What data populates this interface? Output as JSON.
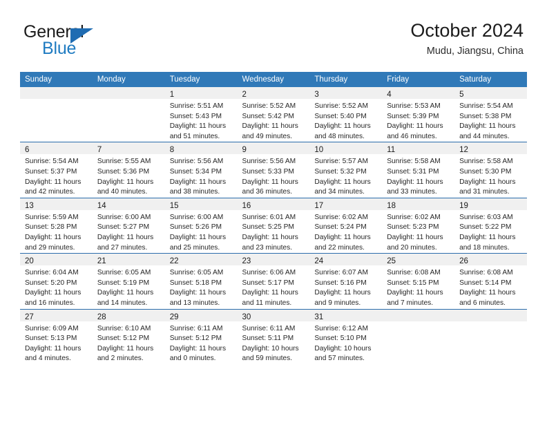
{
  "brand": {
    "name_top": "General",
    "name_bottom": "Blue",
    "triangle_icon": "blue-triangle-icon",
    "color_dark": "#1b1b1b",
    "color_blue": "#1f7bc1"
  },
  "header": {
    "title": "October 2024",
    "subtitle": "Mudu, Jiangsu, China"
  },
  "theme": {
    "header_bg": "#3079b8",
    "header_text": "#ffffff",
    "row_divider": "#2a6cac",
    "daynum_strip_bg": "#f0f0f0",
    "cell_bg": "#ffffff",
    "body_text": "#262626"
  },
  "weekday_headers": [
    "Sunday",
    "Monday",
    "Tuesday",
    "Wednesday",
    "Thursday",
    "Friday",
    "Saturday"
  ],
  "labels": {
    "sunrise": "Sunrise:",
    "sunset": "Sunset:",
    "daylight": "Daylight:"
  },
  "weeks": [
    [
      {
        "day": "",
        "sunrise": "",
        "sunset": "",
        "daylight_line1": "",
        "daylight_line2": "",
        "empty": true
      },
      {
        "day": "",
        "sunrise": "",
        "sunset": "",
        "daylight_line1": "",
        "daylight_line2": "",
        "empty": true
      },
      {
        "day": "1",
        "sunrise": "Sunrise: 5:51 AM",
        "sunset": "Sunset: 5:43 PM",
        "daylight_line1": "Daylight: 11 hours",
        "daylight_line2": "and 51 minutes."
      },
      {
        "day": "2",
        "sunrise": "Sunrise: 5:52 AM",
        "sunset": "Sunset: 5:42 PM",
        "daylight_line1": "Daylight: 11 hours",
        "daylight_line2": "and 49 minutes."
      },
      {
        "day": "3",
        "sunrise": "Sunrise: 5:52 AM",
        "sunset": "Sunset: 5:40 PM",
        "daylight_line1": "Daylight: 11 hours",
        "daylight_line2": "and 48 minutes."
      },
      {
        "day": "4",
        "sunrise": "Sunrise: 5:53 AM",
        "sunset": "Sunset: 5:39 PM",
        "daylight_line1": "Daylight: 11 hours",
        "daylight_line2": "and 46 minutes."
      },
      {
        "day": "5",
        "sunrise": "Sunrise: 5:54 AM",
        "sunset": "Sunset: 5:38 PM",
        "daylight_line1": "Daylight: 11 hours",
        "daylight_line2": "and 44 minutes."
      }
    ],
    [
      {
        "day": "6",
        "sunrise": "Sunrise: 5:54 AM",
        "sunset": "Sunset: 5:37 PM",
        "daylight_line1": "Daylight: 11 hours",
        "daylight_line2": "and 42 minutes."
      },
      {
        "day": "7",
        "sunrise": "Sunrise: 5:55 AM",
        "sunset": "Sunset: 5:36 PM",
        "daylight_line1": "Daylight: 11 hours",
        "daylight_line2": "and 40 minutes."
      },
      {
        "day": "8",
        "sunrise": "Sunrise: 5:56 AM",
        "sunset": "Sunset: 5:34 PM",
        "daylight_line1": "Daylight: 11 hours",
        "daylight_line2": "and 38 minutes."
      },
      {
        "day": "9",
        "sunrise": "Sunrise: 5:56 AM",
        "sunset": "Sunset: 5:33 PM",
        "daylight_line1": "Daylight: 11 hours",
        "daylight_line2": "and 36 minutes."
      },
      {
        "day": "10",
        "sunrise": "Sunrise: 5:57 AM",
        "sunset": "Sunset: 5:32 PM",
        "daylight_line1": "Daylight: 11 hours",
        "daylight_line2": "and 34 minutes."
      },
      {
        "day": "11",
        "sunrise": "Sunrise: 5:58 AM",
        "sunset": "Sunset: 5:31 PM",
        "daylight_line1": "Daylight: 11 hours",
        "daylight_line2": "and 33 minutes."
      },
      {
        "day": "12",
        "sunrise": "Sunrise: 5:58 AM",
        "sunset": "Sunset: 5:30 PM",
        "daylight_line1": "Daylight: 11 hours",
        "daylight_line2": "and 31 minutes."
      }
    ],
    [
      {
        "day": "13",
        "sunrise": "Sunrise: 5:59 AM",
        "sunset": "Sunset: 5:28 PM",
        "daylight_line1": "Daylight: 11 hours",
        "daylight_line2": "and 29 minutes."
      },
      {
        "day": "14",
        "sunrise": "Sunrise: 6:00 AM",
        "sunset": "Sunset: 5:27 PM",
        "daylight_line1": "Daylight: 11 hours",
        "daylight_line2": "and 27 minutes."
      },
      {
        "day": "15",
        "sunrise": "Sunrise: 6:00 AM",
        "sunset": "Sunset: 5:26 PM",
        "daylight_line1": "Daylight: 11 hours",
        "daylight_line2": "and 25 minutes."
      },
      {
        "day": "16",
        "sunrise": "Sunrise: 6:01 AM",
        "sunset": "Sunset: 5:25 PM",
        "daylight_line1": "Daylight: 11 hours",
        "daylight_line2": "and 23 minutes."
      },
      {
        "day": "17",
        "sunrise": "Sunrise: 6:02 AM",
        "sunset": "Sunset: 5:24 PM",
        "daylight_line1": "Daylight: 11 hours",
        "daylight_line2": "and 22 minutes."
      },
      {
        "day": "18",
        "sunrise": "Sunrise: 6:02 AM",
        "sunset": "Sunset: 5:23 PM",
        "daylight_line1": "Daylight: 11 hours",
        "daylight_line2": "and 20 minutes."
      },
      {
        "day": "19",
        "sunrise": "Sunrise: 6:03 AM",
        "sunset": "Sunset: 5:22 PM",
        "daylight_line1": "Daylight: 11 hours",
        "daylight_line2": "and 18 minutes."
      }
    ],
    [
      {
        "day": "20",
        "sunrise": "Sunrise: 6:04 AM",
        "sunset": "Sunset: 5:20 PM",
        "daylight_line1": "Daylight: 11 hours",
        "daylight_line2": "and 16 minutes."
      },
      {
        "day": "21",
        "sunrise": "Sunrise: 6:05 AM",
        "sunset": "Sunset: 5:19 PM",
        "daylight_line1": "Daylight: 11 hours",
        "daylight_line2": "and 14 minutes."
      },
      {
        "day": "22",
        "sunrise": "Sunrise: 6:05 AM",
        "sunset": "Sunset: 5:18 PM",
        "daylight_line1": "Daylight: 11 hours",
        "daylight_line2": "and 13 minutes."
      },
      {
        "day": "23",
        "sunrise": "Sunrise: 6:06 AM",
        "sunset": "Sunset: 5:17 PM",
        "daylight_line1": "Daylight: 11 hours",
        "daylight_line2": "and 11 minutes."
      },
      {
        "day": "24",
        "sunrise": "Sunrise: 6:07 AM",
        "sunset": "Sunset: 5:16 PM",
        "daylight_line1": "Daylight: 11 hours",
        "daylight_line2": "and 9 minutes."
      },
      {
        "day": "25",
        "sunrise": "Sunrise: 6:08 AM",
        "sunset": "Sunset: 5:15 PM",
        "daylight_line1": "Daylight: 11 hours",
        "daylight_line2": "and 7 minutes."
      },
      {
        "day": "26",
        "sunrise": "Sunrise: 6:08 AM",
        "sunset": "Sunset: 5:14 PM",
        "daylight_line1": "Daylight: 11 hours",
        "daylight_line2": "and 6 minutes."
      }
    ],
    [
      {
        "day": "27",
        "sunrise": "Sunrise: 6:09 AM",
        "sunset": "Sunset: 5:13 PM",
        "daylight_line1": "Daylight: 11 hours",
        "daylight_line2": "and 4 minutes."
      },
      {
        "day": "28",
        "sunrise": "Sunrise: 6:10 AM",
        "sunset": "Sunset: 5:12 PM",
        "daylight_line1": "Daylight: 11 hours",
        "daylight_line2": "and 2 minutes."
      },
      {
        "day": "29",
        "sunrise": "Sunrise: 6:11 AM",
        "sunset": "Sunset: 5:12 PM",
        "daylight_line1": "Daylight: 11 hours",
        "daylight_line2": "and 0 minutes."
      },
      {
        "day": "30",
        "sunrise": "Sunrise: 6:11 AM",
        "sunset": "Sunset: 5:11 PM",
        "daylight_line1": "Daylight: 10 hours",
        "daylight_line2": "and 59 minutes."
      },
      {
        "day": "31",
        "sunrise": "Sunrise: 6:12 AM",
        "sunset": "Sunset: 5:10 PM",
        "daylight_line1": "Daylight: 10 hours",
        "daylight_line2": "and 57 minutes."
      },
      {
        "day": "",
        "sunrise": "",
        "sunset": "",
        "daylight_line1": "",
        "daylight_line2": "",
        "empty": true
      },
      {
        "day": "",
        "sunrise": "",
        "sunset": "",
        "daylight_line1": "",
        "daylight_line2": "",
        "empty": true
      }
    ]
  ]
}
